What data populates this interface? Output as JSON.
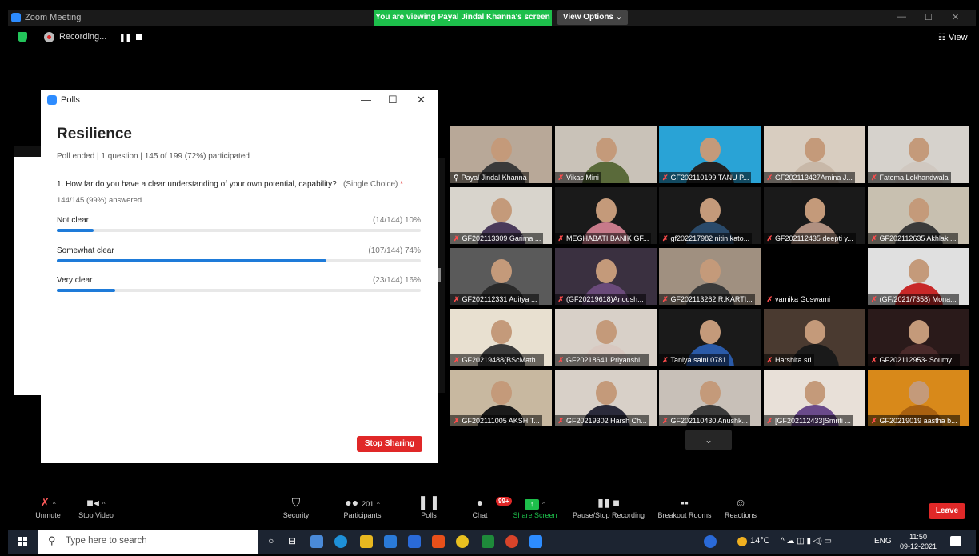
{
  "window": {
    "title": "Zoom Meeting",
    "viewing_banner": "You are viewing Payal Jindal Khanna's screen",
    "view_options": "View Options ⌄",
    "minimize": "—",
    "maximize": "☐",
    "close": "✕"
  },
  "recording": {
    "label": "Recording...",
    "pause": "❚❚",
    "view_label": "☷ View"
  },
  "polls": {
    "window_title": "Polls",
    "title": "Resilience",
    "meta": "Poll ended  |  1 question  |  145 of 199 (72%) participated",
    "question": "1. How far do you have a clear understanding of your own potential, capability?",
    "question_type": "(Single Choice)",
    "required_mark": "*",
    "answered": "144/145 (99%) answered",
    "options": [
      {
        "label": "Not clear",
        "count": "(14/144) 10%",
        "fraction": 0.1
      },
      {
        "label": "Somewhat clear",
        "count": "(107/144) 74%",
        "fraction": 0.74
      },
      {
        "label": "Very clear",
        "count": "(23/144) 16%",
        "fraction": 0.16
      }
    ],
    "stop_sharing": "Stop Sharing"
  },
  "participants": [
    {
      "name": "Payal Jindal Khanna",
      "muted": false,
      "pinned": true,
      "bg": "#b8a898",
      "shirt": "#3a3a3a"
    },
    {
      "name": "Vikas Mini",
      "muted": true,
      "bg": "#c9c2b8",
      "shirt": "#5a6a3a"
    },
    {
      "name": "GF202110199 TANU P...",
      "muted": true,
      "bg": "#29a3d6",
      "shirt": "#222"
    },
    {
      "name": "GF202113427Amina J...",
      "muted": true,
      "bg": "#d8cdc0",
      "shirt": "#c8b8a8"
    },
    {
      "name": "Fatema Lokhandwala",
      "muted": true,
      "bg": "#d6d2cc",
      "shirt": "#d0c8c0"
    },
    {
      "name": "GF202113309 Garima ...",
      "muted": true,
      "bg": "#d8d4cc",
      "shirt": "#4a3a5a"
    },
    {
      "name": "MEGHABATI BANIK GF...",
      "muted": true,
      "bg": "#1a1a1a",
      "shirt": "#c77a8a"
    },
    {
      "name": "gf202217982 nitin kato...",
      "muted": true,
      "bg": "#1a1a1a",
      "shirt": "#2a4a6a"
    },
    {
      "name": "GF202112435 deepti y...",
      "muted": true,
      "bg": "#1a1a1a",
      "shirt": "#b09080"
    },
    {
      "name": "GF202112635 Akhlak ...",
      "muted": true,
      "bg": "#c8c0b0",
      "shirt": "#3a3a3a"
    },
    {
      "name": "GF202112331 Aditya ...",
      "muted": true,
      "bg": "#5a5a5a",
      "shirt": "#2a2a2a"
    },
    {
      "name": "(GF20219618)Anoush...",
      "muted": true,
      "bg": "#3a3040",
      "shirt": "#6a4a7a"
    },
    {
      "name": "GF202113262 R.KARTI...",
      "muted": true,
      "bg": "#a09080",
      "shirt": "#3a3a3a"
    },
    {
      "name": "varnika Goswami",
      "muted": true,
      "bg": "#000000",
      "shirt": "#000000",
      "no_video": true
    },
    {
      "name": "(GF/2021/7358) Mona...",
      "muted": true,
      "bg": "#e0e0e0",
      "shirt": "#c82828"
    },
    {
      "name": "GF20219488(BScMath...",
      "muted": true,
      "bg": "#e8e0d0",
      "shirt": "#3a3a3a"
    },
    {
      "name": "GF20218641 Priyanshi...",
      "muted": true,
      "bg": "#d8d0c8",
      "shirt": "#d8c8c0"
    },
    {
      "name": "Taniya saini 0781",
      "muted": true,
      "bg": "#1a1a1a",
      "shirt": "#2a5aa8"
    },
    {
      "name": "Harshita sri",
      "muted": true,
      "bg": "#4a3a30",
      "shirt": "#1a1a1a"
    },
    {
      "name": "GF202112953- Soumy...",
      "muted": true,
      "bg": "#2a1a1a",
      "shirt": "#4a2a2a"
    },
    {
      "name": "GF202111005 AKSHIT...",
      "muted": true,
      "bg": "#c8b8a0",
      "shirt": "#1a1a1a"
    },
    {
      "name": "GF20219302 Harsh Ch...",
      "muted": true,
      "bg": "#d8d0c8",
      "shirt": "#2a2a3a"
    },
    {
      "name": "GF202110430 Anushk...",
      "muted": true,
      "bg": "#c8c0b8",
      "shirt": "#3a3a3a"
    },
    {
      "name": "[GF202112433]Smriti ...",
      "muted": true,
      "bg": "#e8e0d8",
      "shirt": "#6a4a8a"
    },
    {
      "name": "GF20219019 aastha b...",
      "muted": true,
      "bg": "#d8891a",
      "shirt": "#a86010"
    }
  ],
  "more_participants": "⌄",
  "toolbar": {
    "unmute": "Unmute",
    "stop_video": "Stop Video",
    "security": "Security",
    "participants": "Participants",
    "participants_count": "201",
    "polls": "Polls",
    "chat": "Chat",
    "chat_badge": "99+",
    "share_screen": "Share Screen",
    "pause_stop_recording": "Pause/Stop Recording",
    "breakout_rooms": "Breakout Rooms",
    "reactions": "Reactions",
    "leave": "Leave",
    "caret": "^"
  },
  "taskbar": {
    "search_placeholder": "Type here to search",
    "temperature": "14°C",
    "language": "ENG",
    "time": "11:50",
    "date": "09-12-2021"
  },
  "colors": {
    "accent_green": "#1dbf4b",
    "poll_bar": "#1e7bd9",
    "danger": "#e02828",
    "zoom_blue": "#2d8cff"
  }
}
